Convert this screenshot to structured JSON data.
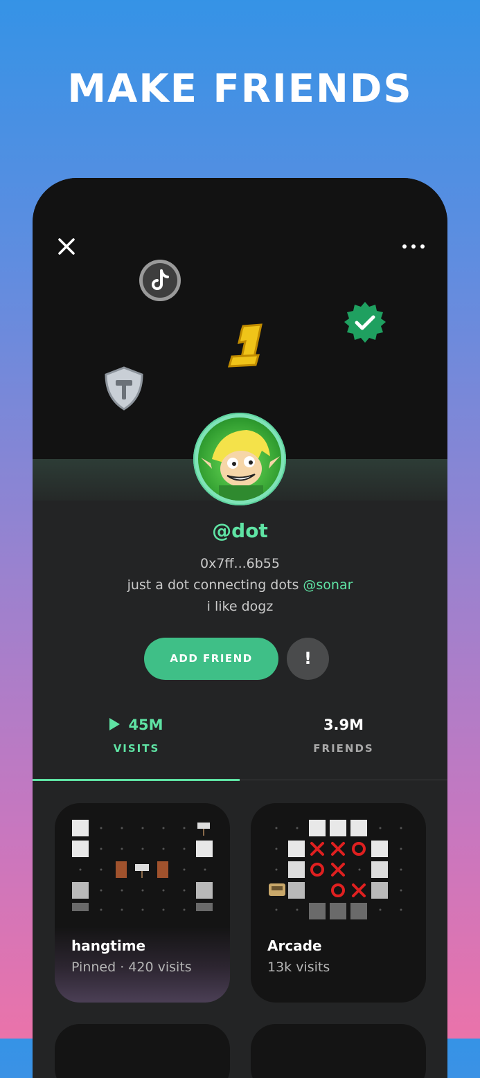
{
  "headline": "MAKE FRIENDS",
  "profile": {
    "username": "@dot",
    "wallet": "0x7ff...6b55",
    "bio_prefix": "just a dot connecting dots ",
    "bio_mention": "@sonar",
    "bio_line2": "i like dogz",
    "badges": [
      "tiktok-badge-icon",
      "verified-badge-icon",
      "number-one-badge-icon",
      "builder-shield-badge-icon"
    ]
  },
  "actions": {
    "add_friend": "ADD FRIEND",
    "report": "!"
  },
  "stats": {
    "visits_value": "45M",
    "visits_label": "VISITS",
    "friends_value": "3.9M",
    "friends_label": "FRIENDS"
  },
  "spaces": [
    {
      "title": "hangtime",
      "subtitle": "Pinned · 420 visits"
    },
    {
      "title": "Arcade",
      "subtitle": "13k visits"
    }
  ],
  "colors": {
    "accent": "#5fe3a4",
    "button": "#3fbf87",
    "panel": "#232425"
  }
}
